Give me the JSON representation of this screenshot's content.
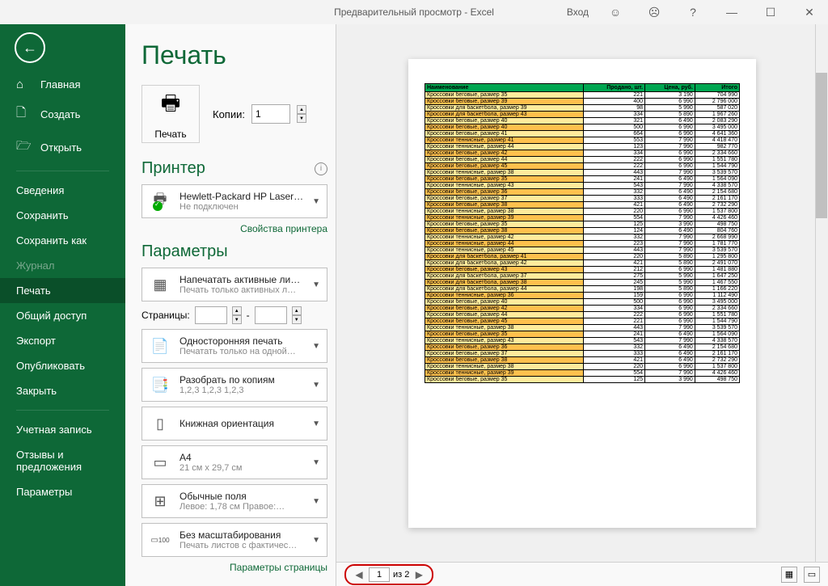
{
  "titlebar": {
    "title": "Предварительный просмотр  -  Excel",
    "signin": "Вход"
  },
  "sidebar": {
    "home": "Главная",
    "new": "Создать",
    "open": "Открыть",
    "info": "Сведения",
    "save": "Сохранить",
    "saveas": "Сохранить как",
    "history": "Журнал",
    "print": "Печать",
    "share": "Общий доступ",
    "export": "Экспорт",
    "publish": "Опубликовать",
    "close": "Закрыть",
    "account": "Учетная запись",
    "feedback": "Отзывы и предложения",
    "options": "Параметры"
  },
  "print": {
    "title": "Печать",
    "button": "Печать",
    "copies_label": "Копии:",
    "copies_value": "1",
    "printer_section": "Принтер",
    "printer_name": "Hewlett-Packard HP LaserJe…",
    "printer_status": "Не подключен",
    "printer_props": "Свойства принтера",
    "params_section": "Параметры",
    "what_main": "Напечатать активные листы",
    "what_sub": "Печать только активных л…",
    "pages_label": "Страницы:",
    "pages_sep": "-",
    "sides_main": "Односторонняя печать",
    "sides_sub": "Печатать только на одной…",
    "collate_main": "Разобрать по копиям",
    "collate_sub": "1,2,3    1,2,3    1,2,3",
    "orientation_main": "Книжная ориентация",
    "size_main": "A4",
    "size_sub": "21 см x 29,7 см",
    "margins_main": "Обычные поля",
    "margins_sub": "Левое:  1,78 см      Правое:…",
    "scaling_main": "Без масштабирования",
    "scaling_sub": "Печать листов с фактичес…",
    "page_setup": "Параметры страницы"
  },
  "preview": {
    "page_current": "1",
    "page_of": "из 2",
    "headers": [
      "Наименование",
      "Продано, шт.",
      "Цена, руб.",
      "Итого"
    ],
    "rows": [
      [
        "Кроссовки беговые, размер 35",
        "221",
        "3 190",
        "704 990"
      ],
      [
        "Кроссовки беговые, размер 39",
        "400",
        "6 990",
        "2 796 000"
      ],
      [
        "Кроссовки для баскетбола, размер 39",
        "98",
        "5 990",
        "587 020"
      ],
      [
        "Кроссовки для баскетбола, размер 43",
        "334",
        "5 890",
        "1 967 260"
      ],
      [
        "Кроссовки беговые, размер 40",
        "321",
        "6 490",
        "2 083 290"
      ],
      [
        "Кроссовки беговые, размер 40",
        "500",
        "6 990",
        "3 495 000"
      ],
      [
        "Кроссовки беговые, размер 41",
        "664",
        "6 990",
        "4 641 360"
      ],
      [
        "Кроссовки теннисные, размер 41",
        "553",
        "7 990",
        "4 418 470"
      ],
      [
        "Кроссовки теннисные, размер 44",
        "123",
        "7 990",
        "982 770"
      ],
      [
        "Кроссовки беговые, размер 42",
        "334",
        "6 990",
        "2 334 660"
      ],
      [
        "Кроссовки беговые, размер 44",
        "222",
        "6 990",
        "1 551 780"
      ],
      [
        "Кроссовки беговые, размер 45",
        "222",
        "6 990",
        "1 544 790"
      ],
      [
        "Кроссовки теннисные, размер 38",
        "443",
        "7 990",
        "3 539 570"
      ],
      [
        "Кроссовки беговые, размер 35",
        "241",
        "6 490",
        "1 564 090"
      ],
      [
        "Кроссовки теннисные, размер 43",
        "543",
        "7 990",
        "4 338 570"
      ],
      [
        "Кроссовки беговые, размер 36",
        "332",
        "6 490",
        "2 154 680"
      ],
      [
        "Кроссовки беговые, размер 37",
        "333",
        "6 490",
        "2 161 170"
      ],
      [
        "Кроссовки беговые, размер 38",
        "421",
        "6 490",
        "2 732 290"
      ],
      [
        "Кроссовки теннисные, размер 38",
        "220",
        "6 990",
        "1 537 800"
      ],
      [
        "Кроссовки теннисные, размер 39",
        "554",
        "7 990",
        "4 426 460"
      ],
      [
        "Кроссовки беговые, размер 35",
        "125",
        "3 990",
        "498 750"
      ],
      [
        "Кроссовки беговые, размер 38",
        "124",
        "6 490",
        "804 760"
      ],
      [
        "Кроссовки теннисные, размер 42",
        "332",
        "7 990",
        "2 668 990"
      ],
      [
        "Кроссовки теннисные, размер 44",
        "223",
        "7 990",
        "1 781 770"
      ],
      [
        "Кроссовки теннисные, размер 45",
        "443",
        "7 990",
        "3 539 570"
      ],
      [
        "Кроссовки для баскетбола, размер 41",
        "220",
        "5 890",
        "1 295 800"
      ],
      [
        "Кроссовки для баскетбола, размер 42",
        "421",
        "5 890",
        "2 491 070"
      ],
      [
        "Кроссовки беговые, размер 43",
        "212",
        "6 990",
        "1 481 880"
      ],
      [
        "Кроссовки для баскетбола, размер 37",
        "275",
        "5 990",
        "1 647 250"
      ],
      [
        "Кроссовки для баскетбола, размер 38",
        "245",
        "5 990",
        "1 467 550"
      ],
      [
        "Кроссовки для баскетбола, размер 44",
        "198",
        "5 890",
        "1 166 220"
      ],
      [
        "Кроссовки теннисные, размер 36",
        "159",
        "6 990",
        "1 112 490"
      ],
      [
        "Кроссовки беговые, размер 40",
        "500",
        "6 990",
        "3 495 000"
      ],
      [
        "Кроссовки беговые, размер 42",
        "334",
        "6 990",
        "2 334 660"
      ],
      [
        "Кроссовки беговые, размер 44",
        "222",
        "6 990",
        "1 551 780"
      ],
      [
        "Кроссовки беговые, размер 45",
        "221",
        "6 990",
        "1 544 790"
      ],
      [
        "Кроссовки теннисные, размер 38",
        "443",
        "7 990",
        "3 539 570"
      ],
      [
        "Кроссовки беговые, размер 35",
        "241",
        "6 490",
        "1 564 090"
      ],
      [
        "Кроссовки теннисные, размер 43",
        "543",
        "7 990",
        "4 338 570"
      ],
      [
        "Кроссовки беговые, размер 36",
        "332",
        "6 490",
        "2 154 680"
      ],
      [
        "Кроссовки беговые, размер 37",
        "333",
        "6 490",
        "2 161 170"
      ],
      [
        "Кроссовки беговые, размер 38",
        "421",
        "6 490",
        "2 732 290"
      ],
      [
        "Кроссовки теннисные, размер 38",
        "220",
        "6 990",
        "1 537 800"
      ],
      [
        "Кроссовки теннисные, размер 39",
        "554",
        "7 990",
        "4 426 460"
      ],
      [
        "Кроссовки беговые, размер 35",
        "125",
        "3 990",
        "498 750"
      ]
    ]
  }
}
